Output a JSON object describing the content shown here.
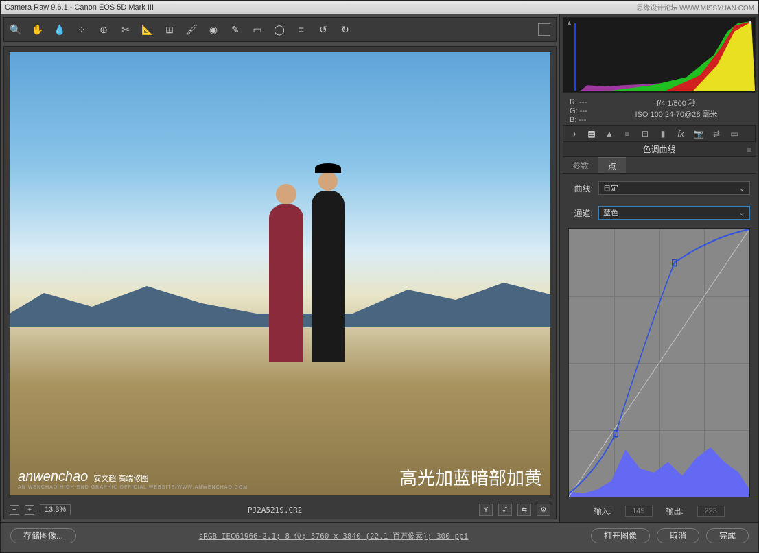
{
  "titlebar": {
    "title": "Camera Raw 9.6.1  -  Canon EOS 5D Mark III",
    "watermark": "思缘设计论坛 WWW.MISSYUAN.COM"
  },
  "toolbar": {
    "tools": [
      "zoom",
      "hand",
      "eyedropper",
      "color-sampler",
      "target",
      "crop",
      "straighten",
      "spot",
      "lens",
      "redeye",
      "adjustment-brush",
      "grad",
      "oval",
      "list",
      "rotate-ccw",
      "rotate-cw"
    ]
  },
  "preview": {
    "watermark_main": "anwenchao",
    "watermark_sub": "安文超 高端修图",
    "watermark_tiny": "AN WENCHAO HIGH-END GRAPHIC OFFICIAL WEBSITE/WWW.ANWENCHAO.COM",
    "caption": "高光加蓝暗部加黄",
    "zoom": "13.3%",
    "filename": "PJ2A5219.CR2"
  },
  "exif": {
    "r": "R: ---",
    "g": "G: ---",
    "b": "B: ---",
    "line1": "f/4  1/500 秒",
    "line2": "ISO 100  24-70@28 毫米"
  },
  "panel": {
    "title": "色调曲线",
    "tab_param": "参数",
    "tab_point": "点",
    "curve_label": "曲线:",
    "curve_value": "自定",
    "channel_label": "通道:",
    "channel_value": "蓝色",
    "input_label": "输入:",
    "input_value": "149",
    "output_label": "输出:",
    "output_value": "223"
  },
  "footer": {
    "save": "存储图像...",
    "info": "sRGB IEC61966-2.1; 8 位; 5760 x 3840 (22.1 百万像素); 300 ppi",
    "open": "打开图像",
    "cancel": "取消",
    "done": "完成"
  },
  "chart_data": [
    {
      "type": "area",
      "title": "histogram",
      "series": [
        {
          "name": "blue-spike",
          "color": "#2040ff",
          "x": [
            15,
            16,
            17
          ],
          "y": [
            0,
            95,
            0
          ]
        },
        {
          "name": "cyan",
          "color": "#00d0d0",
          "x": [
            25,
            30,
            35,
            50,
            70
          ],
          "y": [
            0,
            8,
            5,
            4,
            0
          ]
        },
        {
          "name": "magenta",
          "color": "#d040d0",
          "x": [
            30,
            45,
            70,
            100,
            140
          ],
          "y": [
            0,
            6,
            8,
            9,
            7
          ]
        },
        {
          "name": "green",
          "color": "#20c020",
          "x": [
            70,
            120,
            170,
            210,
            235,
            245,
            250,
            255
          ],
          "y": [
            0,
            6,
            10,
            18,
            35,
            70,
            85,
            95
          ]
        },
        {
          "name": "red",
          "color": "#d02020",
          "x": [
            140,
            180,
            210,
            230,
            245,
            255
          ],
          "y": [
            0,
            10,
            25,
            55,
            88,
            98
          ]
        },
        {
          "name": "yellow",
          "color": "#e8e020",
          "x": [
            180,
            210,
            235,
            250,
            255
          ],
          "y": [
            0,
            15,
            45,
            80,
            95
          ]
        }
      ],
      "xlim": [
        0,
        255
      ],
      "ylim": [
        0,
        100
      ]
    },
    {
      "type": "line",
      "title": "tone-curve-blue",
      "xlabel": "输入",
      "ylabel": "输出",
      "xlim": [
        0,
        255
      ],
      "ylim": [
        0,
        255
      ],
      "points": [
        [
          0,
          3
        ],
        [
          66,
          60
        ],
        [
          149,
          223
        ],
        [
          255,
          255
        ]
      ],
      "background_histogram": {
        "color": "#6060ff",
        "x": [
          0,
          20,
          40,
          60,
          80,
          100,
          120,
          140,
          160,
          180,
          200,
          220,
          240,
          255
        ],
        "y": [
          8,
          5,
          10,
          18,
          50,
          28,
          22,
          32,
          20,
          38,
          48,
          35,
          25,
          8
        ]
      }
    }
  ]
}
